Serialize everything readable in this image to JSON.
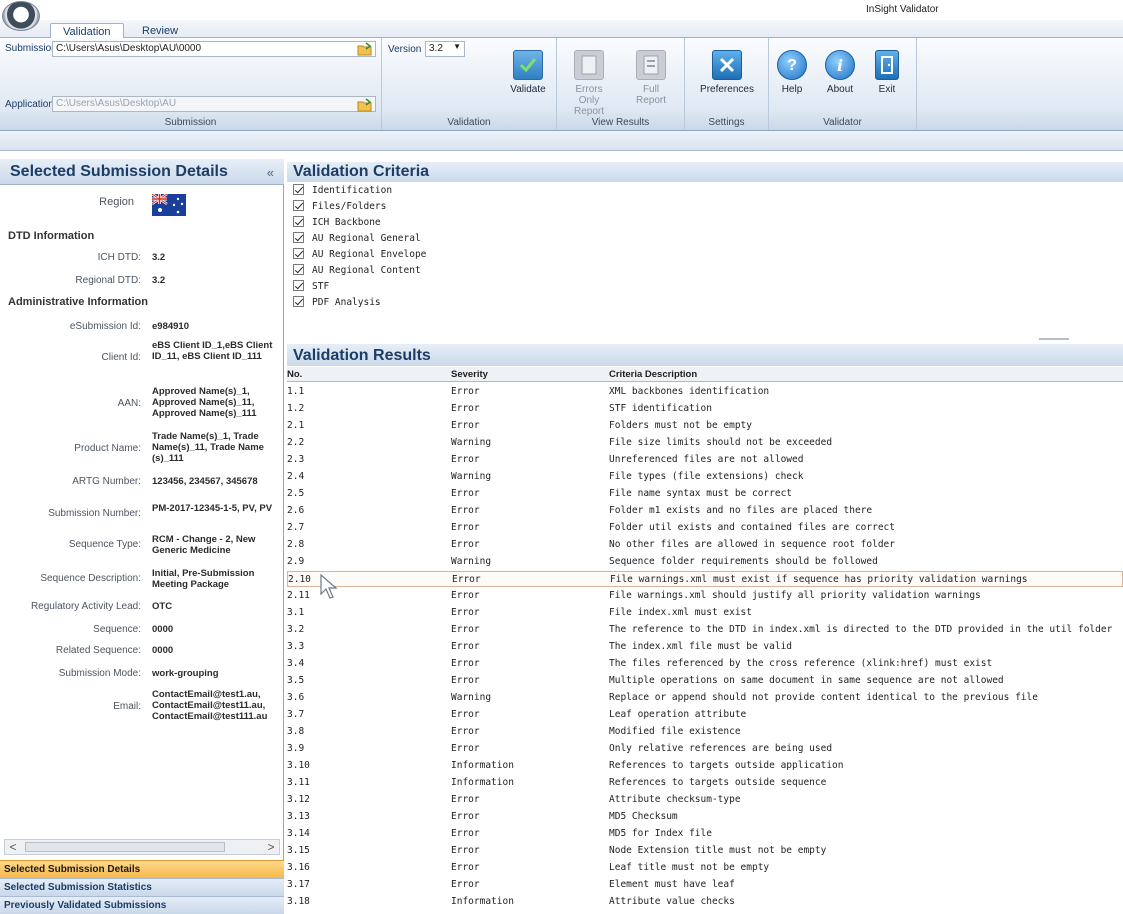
{
  "app": {
    "title": "InSight Validator"
  },
  "tabs": [
    {
      "label": "Validation"
    },
    {
      "label": "Review"
    }
  ],
  "ribbon": {
    "submission": {
      "label": "Submission",
      "value": "C:\\Users\\Asus\\Desktop\\AU\\0000"
    },
    "application": {
      "label": "Application",
      "value": "C:\\Users\\Asus\\Desktop\\AU"
    },
    "group_submission": "Submission",
    "version": {
      "label": "Version",
      "value": "3.2"
    },
    "validate": "Validate",
    "group_validation": "Validation",
    "errors_only": "Errors Only Report",
    "full": "Full Report",
    "group_view": "View Results",
    "preferences": "Preferences",
    "group_settings": "Settings",
    "help": "Help",
    "about": "About",
    "exit": "Exit",
    "group_validator": "Validator"
  },
  "left": {
    "header": "Selected Submission Details",
    "collapse": "«",
    "region_label": "Region",
    "dtd_header": "DTD Information",
    "admin_header": "Administrative Information",
    "fields": [
      {
        "key": "ICH DTD:",
        "value": "3.2"
      },
      {
        "key": "Regional DTD:",
        "value": "3.2"
      },
      {
        "key": "eSubmission Id:",
        "value": "e984910"
      },
      {
        "key": "Client Id:",
        "value": "eBS Client ID_1,eBS Client ID_11, eBS Client ID_111"
      },
      {
        "key": "AAN:",
        "value": "Approved Name(s)_1, Approved Name(s)_11, Approved Name(s)_111"
      },
      {
        "key": "Product Name:",
        "value": "Trade Name(s)_1, Trade Name(s)_11, Trade Name (s)_111"
      },
      {
        "key": "ARTG Number:",
        "value": "123456, 234567, 345678"
      },
      {
        "key": "Submission Number:",
        "value": "PM-2017-12345-1-5, PV, PV"
      },
      {
        "key": "Sequence Type:",
        "value": "RCM - Change - 2, New Generic Medicine"
      },
      {
        "key": "Sequence Description:",
        "value": "Initial, Pre-Submission Meeting Package"
      },
      {
        "key": "Regulatory Activity Lead:",
        "value": "OTC"
      },
      {
        "key": "Sequence:",
        "value": "0000"
      },
      {
        "key": "Related Sequence:",
        "value": "0000"
      },
      {
        "key": "Submission Mode:",
        "value": "work-grouping"
      },
      {
        "key": "Email:",
        "value": "ContactEmail@test1.au, ContactEmail@test11.au, ContactEmail@test111.au"
      }
    ],
    "scroll_left": "<",
    "scroll_right": ">",
    "nav": [
      "Selected Submission Details",
      "Selected Submission Statistics",
      "Previously Validated Submissions"
    ]
  },
  "criteria": {
    "title": "Validation Criteria",
    "items": [
      "Identification",
      "Files/Folders",
      "ICH Backbone",
      "AU Regional General",
      "AU Regional Envelope",
      "AU Regional Content",
      "STF",
      "PDF Analysis"
    ]
  },
  "results": {
    "title": "Validation Results",
    "columns": [
      "No.",
      "Severity",
      "Criteria Description"
    ],
    "rows": [
      [
        "1.1",
        "Error",
        "XML backbones identification"
      ],
      [
        "1.2",
        "Error",
        "STF identification"
      ],
      [
        "2.1",
        "Error",
        "Folders must not be empty"
      ],
      [
        "2.2",
        "Warning",
        "File size limits should not be exceeded"
      ],
      [
        "2.3",
        "Error",
        "Unreferenced files are not allowed"
      ],
      [
        "2.4",
        "Warning",
        "File types (file extensions) check"
      ],
      [
        "2.5",
        "Error",
        "File name syntax must be correct"
      ],
      [
        "2.6",
        "Error",
        "Folder m1 exists and no files are placed there"
      ],
      [
        "2.7",
        "Error",
        "Folder util exists and contained files are correct"
      ],
      [
        "2.8",
        "Error",
        "No other files are allowed in sequence root folder"
      ],
      [
        "2.9",
        "Warning",
        "Sequence folder requirements should be followed"
      ],
      [
        "2.10",
        "Error",
        "File warnings.xml must exist if sequence has priority validation warnings"
      ],
      [
        "2.11",
        "Error",
        "File warnings.xml should justify all priority validation warnings"
      ],
      [
        "3.1",
        "Error",
        "File index.xml must exist"
      ],
      [
        "3.2",
        "Error",
        "The reference to the DTD in index.xml is directed to the DTD provided in the util folder"
      ],
      [
        "3.3",
        "Error",
        "The index.xml file must be valid"
      ],
      [
        "3.4",
        "Error",
        "The files referenced by the cross reference (xlink:href) must exist"
      ],
      [
        "3.5",
        "Error",
        "Multiple operations on same document in same sequence are not allowed"
      ],
      [
        "3.6",
        "Warning",
        "Replace or append should not provide content identical to the previous file"
      ],
      [
        "3.7",
        "Error",
        "Leaf operation attribute"
      ],
      [
        "3.8",
        "Error",
        "Modified file existence"
      ],
      [
        "3.9",
        "Error",
        "Only relative references are being used"
      ],
      [
        "3.10",
        "Information",
        "References to targets outside application"
      ],
      [
        "3.11",
        "Information",
        "References to targets outside sequence"
      ],
      [
        "3.12",
        "Error",
        "Attribute checksum-type"
      ],
      [
        "3.13",
        "Error",
        "MD5 Checksum"
      ],
      [
        "3.14",
        "Error",
        "MD5 for Index file"
      ],
      [
        "3.15",
        "Error",
        "Node Extension title must not be empty"
      ],
      [
        "3.16",
        "Error",
        "Leaf title must not be empty"
      ],
      [
        "3.17",
        "Error",
        "Element must have leaf"
      ],
      [
        "3.18",
        "Information",
        "Attribute value checks"
      ]
    ]
  }
}
